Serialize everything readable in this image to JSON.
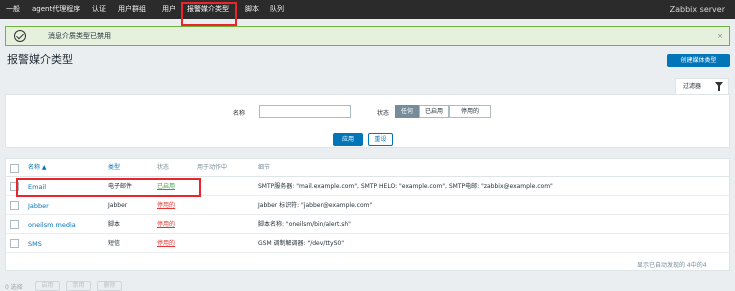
{
  "nav": {
    "items": [
      {
        "label": "一般"
      },
      {
        "label": "agent代理程序"
      },
      {
        "label": "认证"
      },
      {
        "label": "用户群组"
      },
      {
        "label": "用户"
      },
      {
        "label": "报警媒介类型"
      },
      {
        "label": "脚本"
      },
      {
        "label": "队列"
      }
    ],
    "brand": "Zabbix server"
  },
  "message": {
    "text": "消息介质类型已禁用",
    "close": "×"
  },
  "page": {
    "title": "报警媒介类型",
    "create_button": "创建媒体类型"
  },
  "filter": {
    "tab_label": "过滤器",
    "name_label": "名称",
    "name_value": "",
    "status_label": "状态",
    "status_options": [
      "任何",
      "已启用",
      "停用的"
    ],
    "apply_label": "应用",
    "reset_label": "重设"
  },
  "table": {
    "headers": {
      "name": "名称 ▲",
      "type": "类型",
      "status": "状态",
      "used_in_actions": "用于动作中",
      "details": "细节"
    },
    "rows": [
      {
        "name": "Email",
        "type": "电子邮件",
        "status": "已启用",
        "status_kind": "on",
        "details": "SMTP服务器: \"mail.example.com\", SMTP HELO: \"example.com\", SMTP电邮: \"zabbix@example.com\""
      },
      {
        "name": "Jabber",
        "type": "Jabber",
        "status": "停用的",
        "status_kind": "off",
        "details": "Jabber 标识符: \"jabber@example.com\""
      },
      {
        "name": "oneilsm media",
        "type": "脚本",
        "status": "停用的",
        "status_kind": "off",
        "details": "脚本名称: \"oneilsm/bin/alert.sh\""
      },
      {
        "name": "SMS",
        "type": "短信",
        "status": "停用的",
        "status_kind": "off",
        "details": "GSM 调制解调器: \"/dev/ttyS0\""
      }
    ],
    "footer": "显示已自动发现的 4中的4"
  },
  "bottom": {
    "selected": "0 选择",
    "buttons": [
      "启用",
      "禁用",
      "删除"
    ]
  },
  "colors": {
    "accent": "#0275b8",
    "enabled": "#429e47",
    "disabled": "#e33734",
    "highlight": "#e8262c"
  }
}
